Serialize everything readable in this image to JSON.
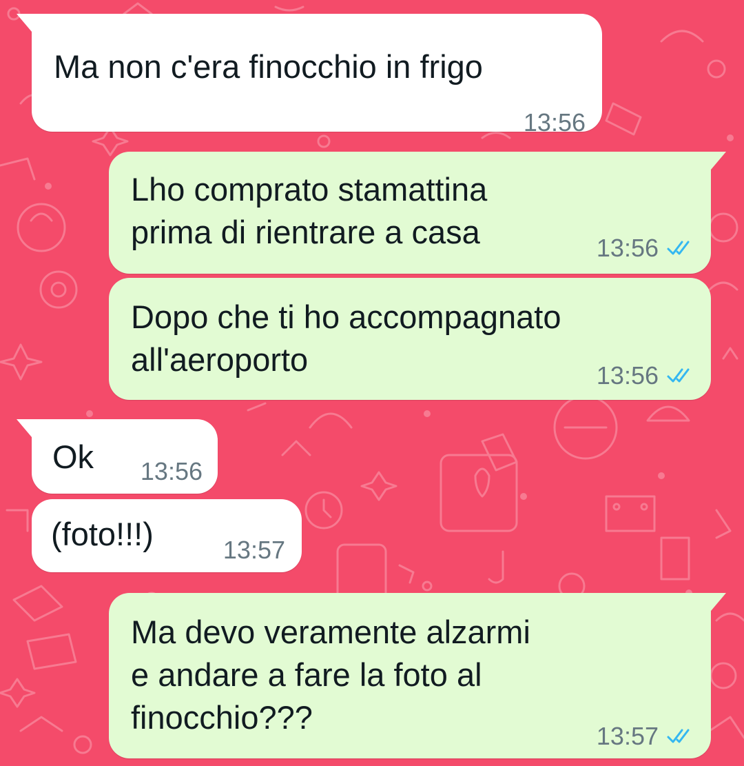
{
  "theme": {
    "background": "#F44B6A",
    "incoming_bubble": "#FFFFFF",
    "outgoing_bubble": "#E2FBD3",
    "read_ticks": "#34B7F1",
    "timestamp": "#667781"
  },
  "messages": [
    {
      "direction": "incoming",
      "text": "Ma non c'era finocchio in frigo",
      "time": "13:56"
    },
    {
      "direction": "outgoing",
      "text": "Lho comprato stamattina\nprima di rientrare a casa",
      "time": "13:56",
      "status": "read"
    },
    {
      "direction": "outgoing",
      "text": "Dopo che ti ho accompagnato\nall'aeroporto",
      "time": "13:56",
      "status": "read"
    },
    {
      "direction": "incoming",
      "text": "Ok",
      "time": "13:56"
    },
    {
      "direction": "incoming",
      "text": "(foto!!!)",
      "time": "13:57"
    },
    {
      "direction": "outgoing",
      "text": "Ma devo veramente alzarmi\ne andare a fare la foto al\nfinocchio???",
      "time": "13:57",
      "status": "read"
    }
  ]
}
